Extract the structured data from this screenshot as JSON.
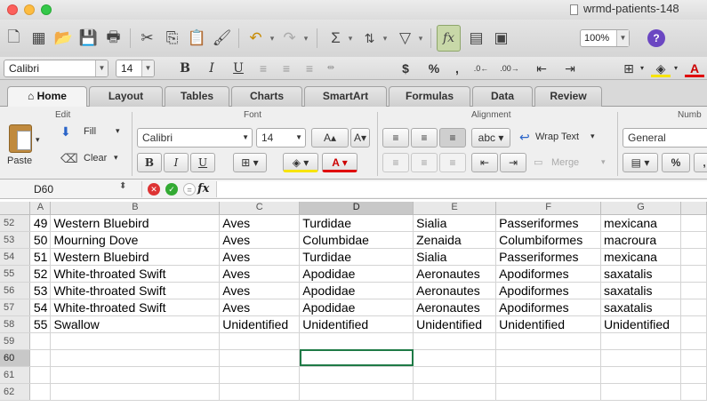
{
  "window": {
    "title": "wrmd-patients-148"
  },
  "toolbar": {
    "zoom": "100%",
    "help": "?"
  },
  "format_bar": {
    "font_name": "Calibri",
    "font_size": "14",
    "bold": "B",
    "italic": "I",
    "underline": "U",
    "currency": "$",
    "percent": "%",
    "comma": ","
  },
  "tabs": [
    {
      "label": "Home",
      "icon": "home-icon"
    },
    {
      "label": "Layout"
    },
    {
      "label": "Tables"
    },
    {
      "label": "Charts"
    },
    {
      "label": "SmartArt"
    },
    {
      "label": "Formulas"
    },
    {
      "label": "Data"
    },
    {
      "label": "Review"
    }
  ],
  "ribbon": {
    "edit": {
      "title": "Edit",
      "paste": "Paste",
      "fill": "Fill",
      "clear": "Clear"
    },
    "font": {
      "title": "Font",
      "name": "Calibri",
      "size": "14",
      "grow": "A▴",
      "shrink": "A▾",
      "bold": "B",
      "italic": "I",
      "underline": "U"
    },
    "alignment": {
      "title": "Alignment",
      "abc": "abc",
      "wrap_text": "Wrap Text",
      "merge": "Merge"
    },
    "number": {
      "title": "Numb",
      "format": "General",
      "percent": "%"
    }
  },
  "formula_bar": {
    "name_box": "D60",
    "fx": "fx",
    "value": ""
  },
  "colors": {
    "accent": "#1f7a46",
    "help": "#6b47c2",
    "fill_color": "#f7e400",
    "font_color": "#e00000"
  },
  "grid": {
    "column_headers": [
      "A",
      "B",
      "C",
      "D",
      "E",
      "F",
      "G"
    ],
    "selected_column": "D",
    "selected_row": "60",
    "rows": [
      {
        "row": "52",
        "cells": [
          "49",
          "Western Bluebird",
          "Aves",
          "Turdidae",
          "Sialia",
          "Passeriformes",
          "mexicana"
        ]
      },
      {
        "row": "53",
        "cells": [
          "50",
          "Mourning Dove",
          "Aves",
          "Columbidae",
          "Zenaida",
          "Columbiformes",
          "macroura"
        ]
      },
      {
        "row": "54",
        "cells": [
          "51",
          "Western Bluebird",
          "Aves",
          "Turdidae",
          "Sialia",
          "Passeriformes",
          "mexicana"
        ]
      },
      {
        "row": "55",
        "cells": [
          "52",
          "White-throated Swift",
          "Aves",
          "Apodidae",
          "Aeronautes",
          "Apodiformes",
          "saxatalis"
        ]
      },
      {
        "row": "56",
        "cells": [
          "53",
          "White-throated Swift",
          "Aves",
          "Apodidae",
          "Aeronautes",
          "Apodiformes",
          "saxatalis"
        ]
      },
      {
        "row": "57",
        "cells": [
          "54",
          "White-throated Swift",
          "Aves",
          "Apodidae",
          "Aeronautes",
          "Apodiformes",
          "saxatalis"
        ]
      },
      {
        "row": "58",
        "cells": [
          "55",
          "Swallow",
          "Unidentified",
          "Unidentified",
          "Unidentified",
          "Unidentified",
          "Unidentified"
        ]
      },
      {
        "row": "59",
        "cells": [
          "",
          "",
          "",
          "",
          "",
          "",
          ""
        ]
      },
      {
        "row": "60",
        "cells": [
          "",
          "",
          "",
          "",
          "",
          "",
          ""
        ]
      },
      {
        "row": "61",
        "cells": [
          "",
          "",
          "",
          "",
          "",
          "",
          ""
        ]
      },
      {
        "row": "62",
        "cells": [
          "",
          "",
          "",
          "",
          "",
          "",
          ""
        ]
      }
    ]
  }
}
